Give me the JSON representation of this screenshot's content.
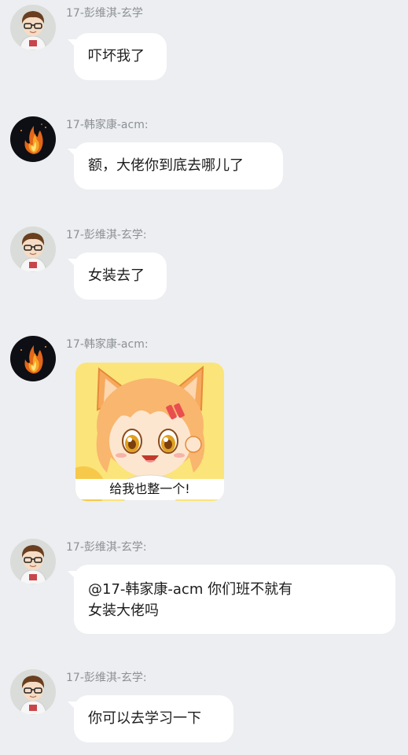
{
  "chat": {
    "messages": [
      {
        "sender": "17-彭维淇-玄学",
        "avatar_icon": "boy-glasses-avatar-icon",
        "text": "吓坏我了"
      },
      {
        "sender": "17-韩家康-acm:",
        "avatar_icon": "fire-avatar-icon",
        "text": "额，大佬你到底去哪儿了"
      },
      {
        "sender": "17-彭维淇-玄学:",
        "avatar_icon": "boy-glasses-avatar-icon",
        "text": "女装去了"
      },
      {
        "sender": "17-韩家康-acm:",
        "avatar_icon": "fire-avatar-icon",
        "sticker_icon": "anime-fox-girl-sticker-icon",
        "sticker_caption": "给我也整一个!"
      },
      {
        "sender": "17-彭维淇-玄学:",
        "avatar_icon": "boy-glasses-avatar-icon",
        "text_lines": [
          "@17-韩家康-acm 你们班不就有",
          "女装大佬吗"
        ]
      },
      {
        "sender": "17-彭维淇-玄学:",
        "avatar_icon": "boy-glasses-avatar-icon",
        "text": "你可以去学习一下"
      }
    ]
  },
  "colors": {
    "background": "#eceef1",
    "bubble": "#ffffff",
    "sender_text": "#8c8f94",
    "message_text": "#1d1d1d"
  }
}
